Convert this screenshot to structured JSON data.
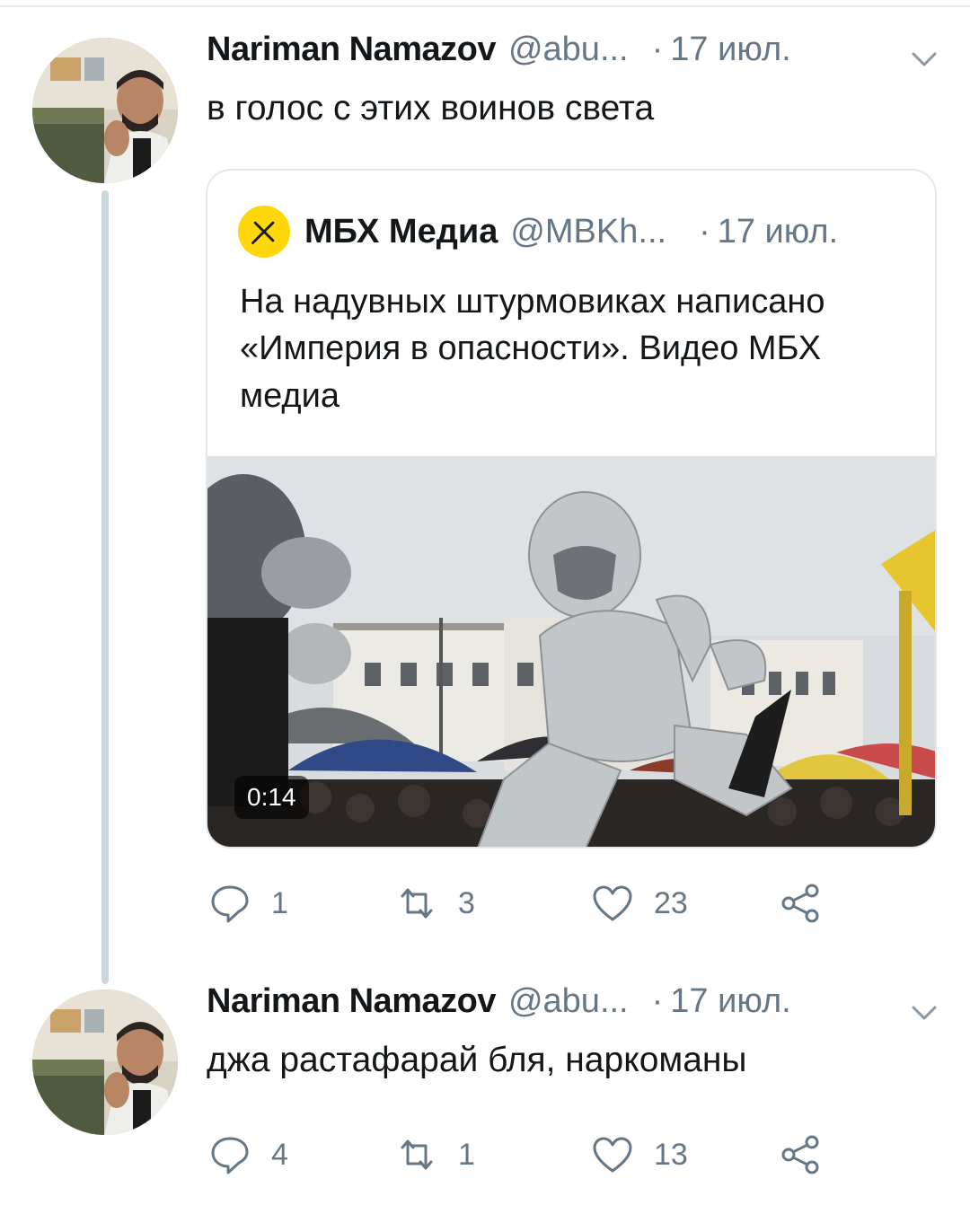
{
  "tweets": [
    {
      "name": "Nariman Namazov",
      "handle": "@abu...",
      "time": "17 июл.",
      "text": "в голос с этих воинов света",
      "quote": {
        "name": "МБХ Медиа",
        "handle": "@MBKh...",
        "time": "17 июл.",
        "text": "На надувных штурмовиках написано «Империя в опасности». Видео МБХ медиа",
        "video_duration": "0:14"
      },
      "actions": {
        "replies": "1",
        "retweets": "3",
        "likes": "23"
      }
    },
    {
      "name": "Nariman Namazov",
      "handle": "@abu...",
      "time": "17 июл.",
      "text": "джа растафарай бля, наркоманы",
      "actions": {
        "replies": "4",
        "retweets": "1",
        "likes": "13"
      }
    }
  ],
  "colors": {
    "text": "#14171a",
    "secondary": "#657786",
    "border": "#e1e8ed",
    "thread": "#ccd6dd",
    "mbh_logo": "#ffd60a"
  },
  "icons": [
    "reply-icon",
    "retweet-icon",
    "like-icon",
    "share-icon",
    "chevron-down-icon"
  ]
}
